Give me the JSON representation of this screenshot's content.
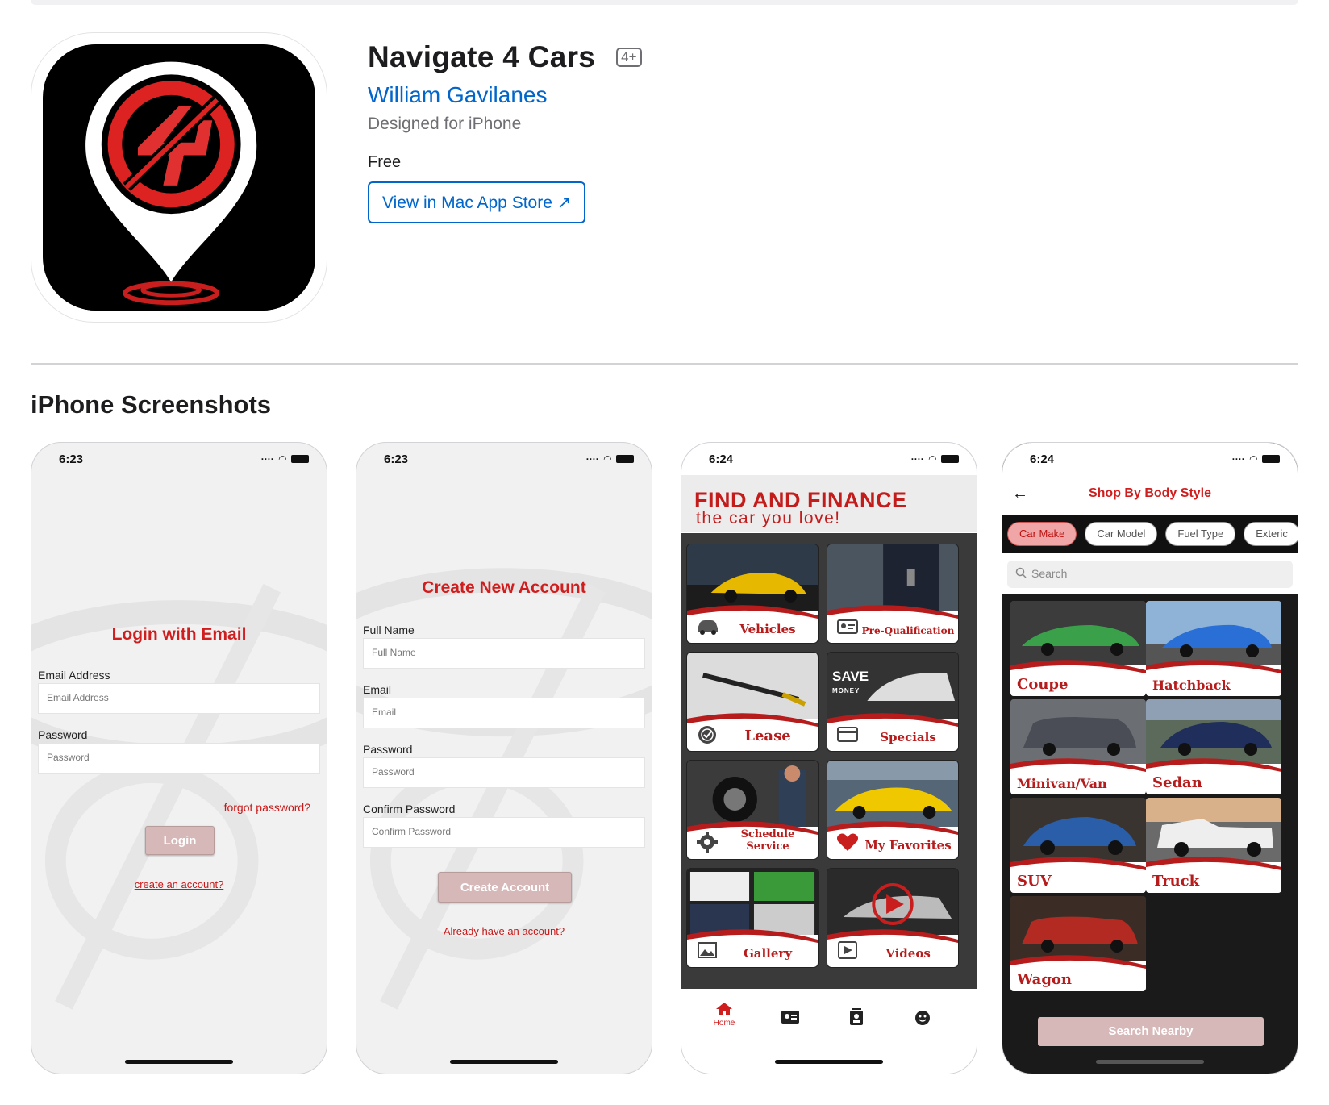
{
  "app": {
    "title": "Navigate 4 Cars",
    "age_rating": "4+",
    "developer": "William Gavilanes",
    "designed_for": "Designed for iPhone",
    "price": "Free",
    "store_button": "View in Mac App Store ↗"
  },
  "section_title": "iPhone Screenshots",
  "colors": {
    "accent": "#0066cc",
    "brand_red": "#d01e1e",
    "rose_button": "#d7b8b8"
  },
  "screens": [
    {
      "time": "6:23",
      "title": "Login with Email",
      "email_label": "Email Address",
      "email_placeholder": "Email Address",
      "password_label": "Password",
      "password_placeholder": "Password",
      "forgot": "forgot password?",
      "login_button": "Login",
      "create_link": "create an account?"
    },
    {
      "time": "6:23",
      "title": "Create New Account",
      "fullname_label": "Full Name",
      "fullname_placeholder": "Full Name",
      "email_label": "Email",
      "email_placeholder": "Email",
      "password_label": "Password",
      "password_placeholder": "Password",
      "confirm_label": "Confirm Password",
      "confirm_placeholder": "Confirm Password",
      "create_button": "Create Account",
      "have_account_link": "Already have an account?"
    },
    {
      "time": "6:24",
      "hero_line1": "FIND AND FINANCE",
      "hero_line2": "the car you love!",
      "save_badge_top": "SAVE",
      "save_badge_bottom": "MONEY",
      "tiles": [
        {
          "label": "Vehicles",
          "icon": "car-icon"
        },
        {
          "label": "Pre-Qualification",
          "icon": "id-card-icon"
        },
        {
          "label": "Lease",
          "icon": "badge-check-icon"
        },
        {
          "label": "Specials",
          "icon": "credit-card-icon"
        },
        {
          "label": "Schedule Service",
          "icon": "gear-icon"
        },
        {
          "label": "My Favorites",
          "icon": "heart-icon"
        },
        {
          "label": "Gallery",
          "icon": "image-icon"
        },
        {
          "label": "Videos",
          "icon": "play-icon"
        }
      ],
      "tabs": [
        {
          "label": "Home",
          "icon": "home-icon"
        },
        {
          "label": "",
          "icon": "profile-card-icon"
        },
        {
          "label": "",
          "icon": "contact-icon"
        },
        {
          "label": "",
          "icon": "smiley-icon"
        }
      ]
    },
    {
      "time": "6:24",
      "nav_title": "Shop By Body Style",
      "chips": [
        "Car Make",
        "Car Model",
        "Fuel Type",
        "Exteric"
      ],
      "search_placeholder": "Search",
      "body_styles": [
        "Coupe",
        "Hatchback",
        "Minivan/Van",
        "Sedan",
        "SUV",
        "Truck",
        "Wagon"
      ],
      "nearby_button": "Search Nearby"
    }
  ]
}
